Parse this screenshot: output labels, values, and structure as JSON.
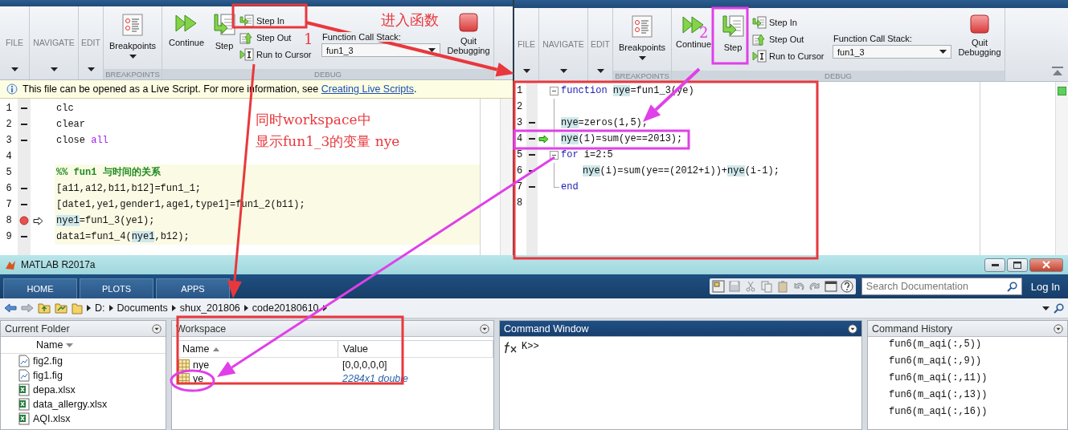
{
  "editors": [
    {
      "ribbon": {
        "menus": [
          {
            "label": "FILE"
          },
          {
            "label": "NAVIGATE"
          },
          {
            "label": "EDIT"
          }
        ],
        "breakpoints": {
          "label": "Breakpoints",
          "group": "BREAKPOINTS"
        },
        "debug": {
          "continue": "Continue",
          "step": "Step",
          "step_in": "Step In",
          "step_out": "Step Out",
          "run_to_cursor": "Run to Cursor",
          "call_stack_label": "Function Call Stack:",
          "call_stack_value": "fun1_3",
          "quit": "Quit Debugging",
          "group": "DEBUG"
        }
      },
      "info_bar": {
        "text": "This file can be opened as a Live Script. For more information, see ",
        "link": "Creating Live Scripts",
        "after": "."
      },
      "lines": [
        {
          "number": "1",
          "executable": true,
          "breakpoint": false,
          "arrow": false,
          "section": false,
          "parts": [
            {
              "text": "clc"
            }
          ]
        },
        {
          "number": "2",
          "executable": true,
          "breakpoint": false,
          "arrow": false,
          "section": false,
          "parts": [
            {
              "text": "clear"
            }
          ]
        },
        {
          "number": "3",
          "executable": true,
          "breakpoint": false,
          "arrow": false,
          "section": false,
          "parts": [
            {
              "text": "close "
            },
            {
              "text": "all",
              "kind": "string"
            }
          ]
        },
        {
          "number": "4",
          "executable": false,
          "breakpoint": false,
          "arrow": false,
          "section": false
        },
        {
          "number": "5",
          "executable": false,
          "breakpoint": false,
          "arrow": false,
          "section": true,
          "parts": [
            {
              "text": "%% fun1 与时间的关系",
              "kind": "comment"
            }
          ]
        },
        {
          "number": "6",
          "executable": true,
          "breakpoint": false,
          "arrow": false,
          "section": true,
          "parts": [
            {
              "text": "[a11,a12,b11,b12]=fun1_1;"
            }
          ]
        },
        {
          "number": "7",
          "executable": true,
          "breakpoint": false,
          "arrow": false,
          "section": true,
          "parts": [
            {
              "text": "[date1,ye1,gender1,age1,type1]=fun1_2(b11);"
            }
          ]
        },
        {
          "number": "8",
          "executable": true,
          "breakpoint": true,
          "arrow": true,
          "section": true,
          "parts": [
            {
              "text": "nye1",
              "kind": "variable"
            },
            {
              "text": "=fun1_3(ye1);"
            }
          ]
        },
        {
          "number": "9",
          "executable": true,
          "breakpoint": false,
          "arrow": false,
          "section": true,
          "parts": [
            {
              "text": "data1=fun1_4("
            },
            {
              "text": "nye1",
              "kind": "variable"
            },
            {
              "text": ",b12);"
            }
          ]
        }
      ]
    },
    {
      "ribbon": {
        "menus": [
          {
            "label": "FILE"
          },
          {
            "label": "NAVIGATE"
          },
          {
            "label": "EDIT"
          }
        ],
        "breakpoints": {
          "label": "Breakpoints",
          "group": "BREAKPOINTS"
        },
        "debug": {
          "continue": "Continue",
          "step": "Step",
          "step_in": "Step In",
          "step_out": "Step Out",
          "run_to_cursor": "Run to Cursor",
          "call_stack_label": "Function Call Stack:",
          "call_stack_value": "fun1_3",
          "quit": "Quit Debugging",
          "group": "DEBUG"
        }
      },
      "lines": [
        {
          "number": "1",
          "executable": false,
          "breakpoint": false,
          "arrow": false,
          "expanded": true,
          "parts": [
            {
              "text": "function ",
              "kind": "keyword"
            },
            {
              "text": "nye",
              "kind": "variable"
            },
            {
              "text": "=fun1_3(ye)"
            }
          ]
        },
        {
          "number": "2",
          "executable": false,
          "breakpoint": false,
          "arrow": false
        },
        {
          "number": "3",
          "executable": true,
          "breakpoint": false,
          "arrow": false,
          "parts": [
            {
              "text": "nye",
              "kind": "variable"
            },
            {
              "text": "=zeros(1,5);"
            }
          ]
        },
        {
          "number": "4",
          "executable": true,
          "breakpoint": false,
          "arrow": true,
          "parts": [
            {
              "text": "nye",
              "kind": "variable"
            },
            {
              "text": "(1)=sum(ye==2013);"
            }
          ]
        },
        {
          "number": "5",
          "executable": true,
          "breakpoint": false,
          "arrow": false,
          "expanded": true,
          "parts": [
            {
              "text": "for",
              "kind": "keyword"
            },
            {
              "text": " i=2:5"
            }
          ]
        },
        {
          "number": "6",
          "executable": true,
          "breakpoint": false,
          "arrow": false,
          "indented": true,
          "parts": [
            {
              "text": "nye",
              "kind": "variable"
            },
            {
              "text": "(i)=sum(ye==(2012+i))+"
            },
            {
              "text": "nye",
              "kind": "variable"
            },
            {
              "text": "(i-1);"
            }
          ]
        },
        {
          "number": "7",
          "executable": true,
          "breakpoint": false,
          "arrow": false,
          "block_end": true,
          "parts": [
            {
              "text": "end",
              "kind": "keyword"
            }
          ]
        },
        {
          "number": "8",
          "executable": false,
          "breakpoint": false,
          "arrow": false
        }
      ]
    }
  ],
  "main": {
    "title": "MATLAB R2017a",
    "tabs": [
      {
        "label": "HOME"
      },
      {
        "label": "PLOTS"
      },
      {
        "label": "APPS"
      }
    ],
    "search": {
      "placeholder": "Search Documentation"
    },
    "login": "Log In",
    "path": [
      "D:",
      "Documents",
      "shux_201806",
      "code20180610"
    ],
    "current_folder": {
      "title": "Current Folder",
      "active": false,
      "column": "Name",
      "files": [
        {
          "name": "fig2.fig",
          "kind": "fig"
        },
        {
          "name": "fig1.fig",
          "kind": "fig"
        },
        {
          "name": "depa.xlsx",
          "kind": "xlsx"
        },
        {
          "name": "data_allergy.xlsx",
          "kind": "xlsx"
        },
        {
          "name": "AQI.xlsx",
          "kind": "xlsx"
        }
      ]
    },
    "workspace": {
      "title": "Workspace",
      "active": false,
      "columns": [
        "Name",
        "Value"
      ],
      "rows": [
        {
          "name": "nye",
          "value": "[0,0,0,0,0]",
          "kind": "array"
        },
        {
          "name": "ye",
          "value": "2284x1 double",
          "kind": "summary"
        }
      ]
    },
    "command_window": {
      "title": "Command Window",
      "active": true,
      "prompt": "K>>"
    },
    "command_history": {
      "title": "Command History",
      "active": false,
      "items": [
        "fun6(m_aqi(:,5))",
        "fun6(m_aqi(:,9))",
        "fun6(m_aqi(:,11))",
        "fun6(m_aqi(:,13))",
        "fun6(m_aqi(:,16))"
      ]
    }
  },
  "annotations": {
    "boxes": [
      {
        "kind": "rect",
        "color": "#e8383d"
      },
      {
        "kind": "rect",
        "color": "#e8383d"
      },
      {
        "kind": "rect",
        "color": "#e8383d"
      },
      {
        "kind": "rect",
        "color": "#e040e8"
      },
      {
        "kind": "rect",
        "color": "#e040e8"
      },
      {
        "kind": "ellipse",
        "color": "#e040e8"
      }
    ],
    "arrows": [
      {
        "color": "#e8383d"
      },
      {
        "color": "#e8383d"
      },
      {
        "color": "#e040e8"
      },
      {
        "color": "#e040e8"
      }
    ],
    "notes": [
      {
        "text": "进入函数",
        "color": "#e8383d"
      },
      {
        "text": "1",
        "color": "#e8383d"
      },
      {
        "text": "2",
        "color": "#e040e8"
      },
      {
        "text": "同时workspace中",
        "color": "#e8383d"
      },
      {
        "text": "显示fun1_3的变量 nye",
        "color": "#e8383d"
      }
    ]
  }
}
